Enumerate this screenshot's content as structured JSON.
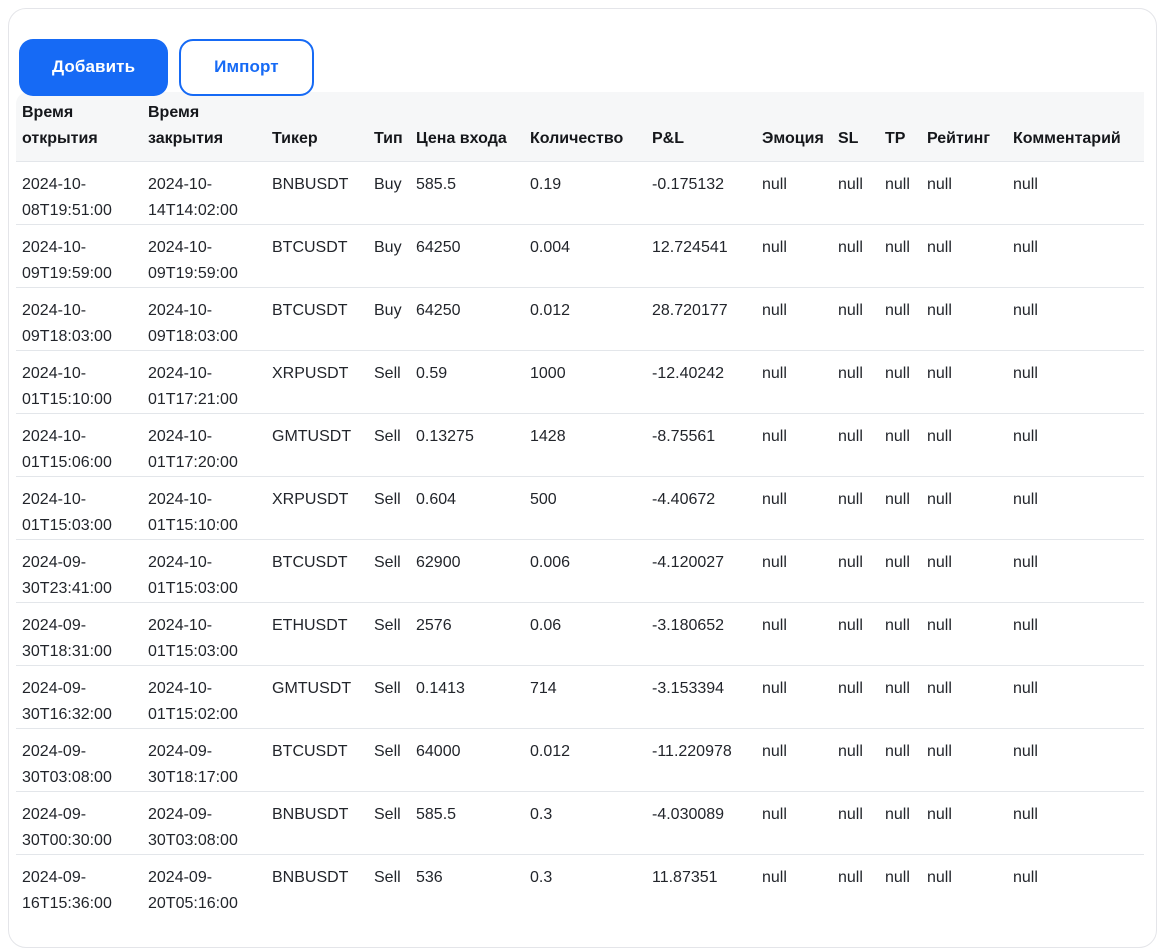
{
  "toolbar": {
    "add_label": "Добавить",
    "import_label": "Импорт"
  },
  "colors": {
    "primary": "#166af5",
    "header_bg": "#f6f7f8",
    "row_divider": "#e3e6ea",
    "card_border": "#e4e5e9"
  },
  "table": {
    "columns": [
      {
        "key": "open_time",
        "label": "Время открытия"
      },
      {
        "key": "close_time",
        "label": "Время закрытия"
      },
      {
        "key": "ticker",
        "label": "Тикер"
      },
      {
        "key": "type",
        "label": "Тип"
      },
      {
        "key": "entry_price",
        "label": "Цена входа"
      },
      {
        "key": "quantity",
        "label": "Количество"
      },
      {
        "key": "pnl",
        "label": "P&L"
      },
      {
        "key": "emotion",
        "label": "Эмоция"
      },
      {
        "key": "sl",
        "label": "SL"
      },
      {
        "key": "tp",
        "label": "TP"
      },
      {
        "key": "rating",
        "label": "Рейтинг"
      },
      {
        "key": "comment",
        "label": "Комментарий"
      }
    ],
    "rows": [
      [
        "2024-10-08T19:51:00",
        "2024-10-14T14:02:00",
        "BNBUSDT",
        "Buy",
        "585.5",
        "0.19",
        "-0.175132",
        "null",
        "null",
        "null",
        "null",
        "null"
      ],
      [
        "2024-10-09T19:59:00",
        "2024-10-09T19:59:00",
        "BTCUSDT",
        "Buy",
        "64250",
        "0.004",
        "12.724541",
        "null",
        "null",
        "null",
        "null",
        "null"
      ],
      [
        "2024-10-09T18:03:00",
        "2024-10-09T18:03:00",
        "BTCUSDT",
        "Buy",
        "64250",
        "0.012",
        "28.720177",
        "null",
        "null",
        "null",
        "null",
        "null"
      ],
      [
        "2024-10-01T15:10:00",
        "2024-10-01T17:21:00",
        "XRPUSDT",
        "Sell",
        "0.59",
        "1000",
        "-12.40242",
        "null",
        "null",
        "null",
        "null",
        "null"
      ],
      [
        "2024-10-01T15:06:00",
        "2024-10-01T17:20:00",
        "GMTUSDT",
        "Sell",
        "0.13275",
        "1428",
        "-8.75561",
        "null",
        "null",
        "null",
        "null",
        "null"
      ],
      [
        "2024-10-01T15:03:00",
        "2024-10-01T15:10:00",
        "XRPUSDT",
        "Sell",
        "0.604",
        "500",
        "-4.40672",
        "null",
        "null",
        "null",
        "null",
        "null"
      ],
      [
        "2024-09-30T23:41:00",
        "2024-10-01T15:03:00",
        "BTCUSDT",
        "Sell",
        "62900",
        "0.006",
        "-4.120027",
        "null",
        "null",
        "null",
        "null",
        "null"
      ],
      [
        "2024-09-30T18:31:00",
        "2024-10-01T15:03:00",
        "ETHUSDT",
        "Sell",
        "2576",
        "0.06",
        "-3.180652",
        "null",
        "null",
        "null",
        "null",
        "null"
      ],
      [
        "2024-09-30T16:32:00",
        "2024-10-01T15:02:00",
        "GMTUSDT",
        "Sell",
        "0.1413",
        "714",
        "-3.153394",
        "null",
        "null",
        "null",
        "null",
        "null"
      ],
      [
        "2024-09-30T03:08:00",
        "2024-09-30T18:17:00",
        "BTCUSDT",
        "Sell",
        "64000",
        "0.012",
        "-11.220978",
        "null",
        "null",
        "null",
        "null",
        "null"
      ],
      [
        "2024-09-30T00:30:00",
        "2024-09-30T03:08:00",
        "BNBUSDT",
        "Sell",
        "585.5",
        "0.3",
        "-4.030089",
        "null",
        "null",
        "null",
        "null",
        "null"
      ],
      [
        "2024-09-16T15:36:00",
        "2024-09-20T05:16:00",
        "BNBUSDT",
        "Sell",
        "536",
        "0.3",
        "11.87351",
        "null",
        "null",
        "null",
        "null",
        "null"
      ]
    ]
  }
}
